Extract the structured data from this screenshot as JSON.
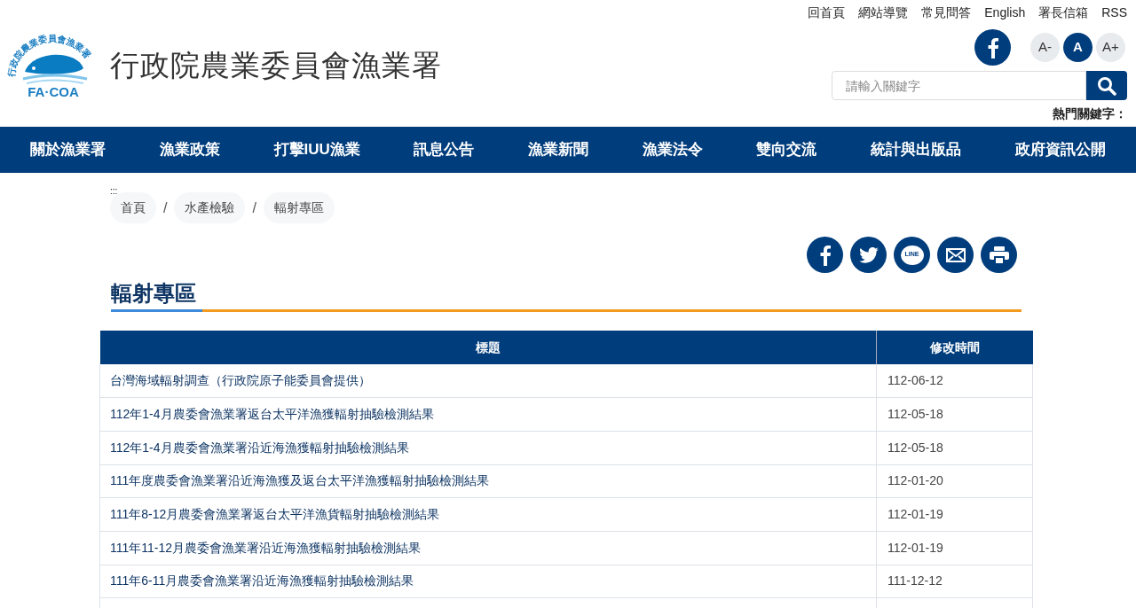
{
  "logo": {
    "arc_text": "行政院農業委員會漁業署",
    "abbr": "FA·COA",
    "title": "行政院農業委員會漁業署"
  },
  "top_links": [
    "回首頁",
    "網站導覽",
    "常見問答",
    "English",
    "署長信箱",
    "RSS"
  ],
  "font_sizes": [
    {
      "label": "A-",
      "selected": false
    },
    {
      "label": "A",
      "selected": true
    },
    {
      "label": "A+",
      "selected": false
    }
  ],
  "search": {
    "placeholder": "請輸入關鍵字"
  },
  "hot_keywords_label": "熱門關鍵字：",
  "nav": [
    "關於漁業署",
    "漁業政策",
    "打擊IUU漁業",
    "訊息公告",
    "漁業新聞",
    "漁業法令",
    "雙向交流",
    "統計與出版品",
    "政府資訊公開"
  ],
  "accesskey": ":::",
  "breadcrumb": [
    "首頁",
    "水產檢驗",
    "輻射專區"
  ],
  "breadcrumb_separators": [
    "/",
    "/"
  ],
  "share": [
    {
      "kind": "facebook"
    },
    {
      "kind": "twitter"
    },
    {
      "kind": "line",
      "label": "LINE"
    },
    {
      "kind": "mail"
    },
    {
      "kind": "print"
    }
  ],
  "page_title": "輻射專區",
  "table": {
    "columns": [
      "標題",
      "修改時間"
    ],
    "rows": [
      {
        "title": "台灣海域輻射調查（行政院原子能委員會提供）",
        "date": "112-06-12"
      },
      {
        "title": "112年1-4月農委會漁業署返台太平洋漁獲輻射抽驗檢測結果",
        "date": "112-05-18"
      },
      {
        "title": "112年1-4月農委會漁業署沿近海漁獲輻射抽驗檢測結果",
        "date": "112-05-18"
      },
      {
        "title": "111年度農委會漁業署沿近海漁獲及返台太平洋漁獲輻射抽驗檢測結果",
        "date": "112-01-20"
      },
      {
        "title": "111年8-12月農委會漁業署返台太平洋漁貨輻射抽驗檢測結果",
        "date": "112-01-19"
      },
      {
        "title": "111年11-12月農委會漁業署沿近海漁獲輻射抽驗檢測結果",
        "date": "112-01-19"
      },
      {
        "title": "111年6-11月農委會漁業署沿近海漁獲輻射抽驗檢測結果",
        "date": "111-12-12"
      }
    ]
  }
}
